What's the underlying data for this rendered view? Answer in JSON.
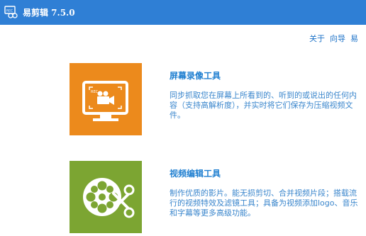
{
  "titlebar": {
    "app_name": "易剪辑 7.5.0",
    "icon": "app-logo-icon"
  },
  "topnav": {
    "items": [
      "关于",
      "向导",
      "易"
    ]
  },
  "features": [
    {
      "icon": "monitor-camera-icon",
      "title": "屏幕录像工具",
      "description": "同步抓取您在屏幕上所看到的、听到的或说出的任何内容（支持高解析度），并实时将它们保存为压缩视频文件。",
      "color": "#ec8a1c"
    },
    {
      "icon": "film-reel-scissors-icon",
      "title": "视频编辑工具",
      "description": "制作优质的影片。能无损剪切、合并视频片段；搭载流行的视频特效及滤镜工具；具备为视频添加logo、音乐和字幕等更多高级功能。",
      "color": "#7ca532"
    }
  ],
  "colors": {
    "titlebar": "#2f7fd5",
    "link": "#1e73c8",
    "title_text": "#1f7fd0",
    "desc_text": "#3a86cc"
  }
}
